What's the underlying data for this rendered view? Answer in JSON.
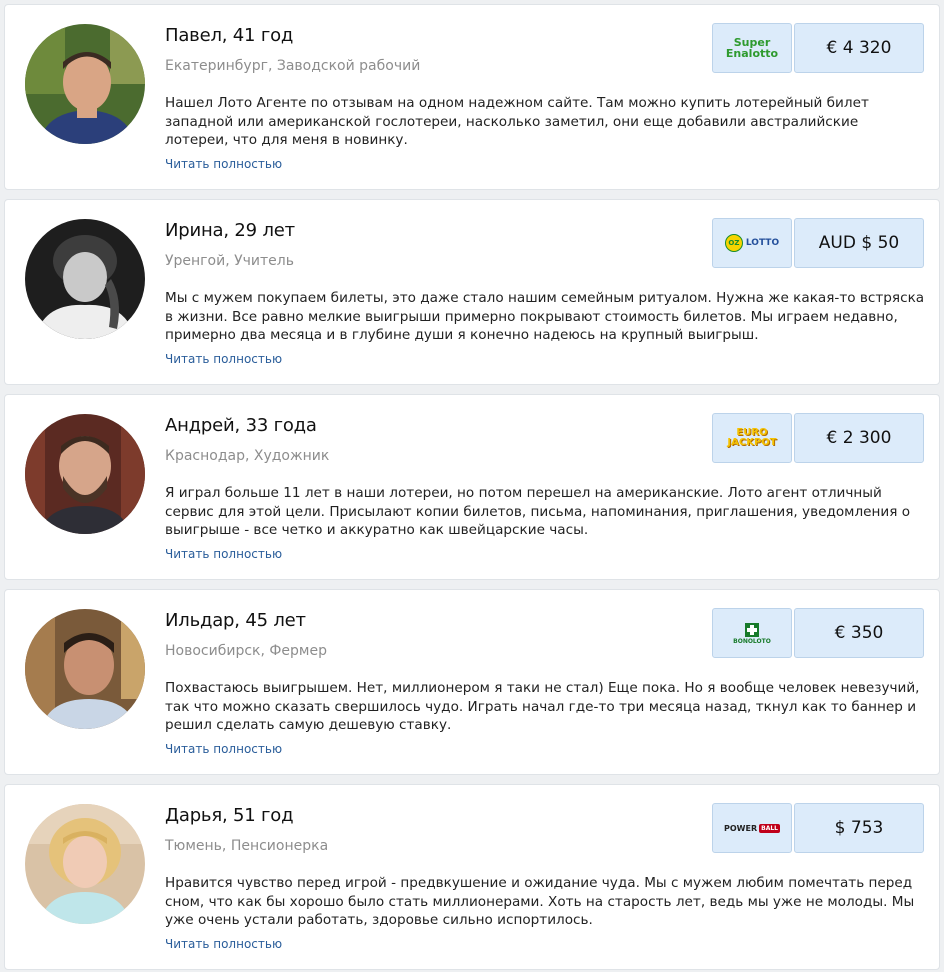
{
  "reviews": [
    {
      "name": "Павел, 41 год",
      "meta": "Екатеринбург, Заводской рабочий",
      "text": "Нашел Лото Агенте по отзывам на одном надежном сайте. Там можно купить лотерейный билет западной или американской гослотереи, насколько заметил, они еще добавили австралийские лотереи, что для меня в новинку.",
      "more": "Читать полностью",
      "lottery_line1": "Super",
      "lottery_line2": "Enalotto",
      "prize": "€ 4 320"
    },
    {
      "name": "Ирина, 29 лет",
      "meta": "Уренгой, Учитель",
      "text": "Мы с мужем покупаем билеты, это даже стало нашим семейным ритуалом. Нужна же какая-то встряска в жизни. Все равно мелкие выигрыши примерно покрывают стоимость билетов. Мы играем недавно, примерно два месяца и в глубине души я конечно надеюсь на крупный выигрыш.",
      "more": "Читать полностью",
      "lottery_line1": "OZ",
      "lottery_line2": "LOTTO",
      "prize": "AUD $ 50"
    },
    {
      "name": "Андрей, 33 года",
      "meta": "Краснодар, Художник",
      "text": "Я играл больше 11 лет в наши лотереи, но потом перешел на американские. Лото агент отличный сервис для этой цели. Присылают копии билетов, письма, напоминания, приглашения, уведомления о выигрыше - все четко и аккуратно как швейцарские часы.",
      "more": "Читать полностью",
      "lottery_line1": "EURO",
      "lottery_line2": "JACKPOT",
      "prize": "€ 2 300"
    },
    {
      "name": "Ильдар, 45 лет",
      "meta": "Новосибирск, Фермер",
      "text": "Похвастаюсь выигрышем. Нет, миллионером я таки не стал) Еще пока. Но я вообще человек невезучий, так что можно сказать свершилось чудо. Играть начал где-то три месяца назад, ткнул как то баннер и решил сделать самую дешевую ставку.",
      "more": "Читать полностью",
      "lottery_line1": "",
      "lottery_line2": "BONOLOTO",
      "prize": "€ 350"
    },
    {
      "name": "Дарья, 51 год",
      "meta": "Тюмень, Пенсионерка",
      "text": "Нравится чувство перед игрой - предвкушение и ожидание чуда. Мы с мужем любим помечтать перед сном, что как бы хорошо было стать миллионерами. Хоть на старость лет, ведь мы уже не молоды. Мы уже очень устали работать, здоровье сильно испортилось.",
      "more": "Читать полностью",
      "lottery_line1": "POWER",
      "lottery_line2": "BALL",
      "prize": "$ 753"
    }
  ],
  "colors": {
    "page_bg": "#eef0f2",
    "card_bg": "#ffffff",
    "badge_bg": "#dcebfa",
    "badge_border": "#bcd3ea",
    "link": "#2a5d9a",
    "meta": "#8d8d8d"
  }
}
